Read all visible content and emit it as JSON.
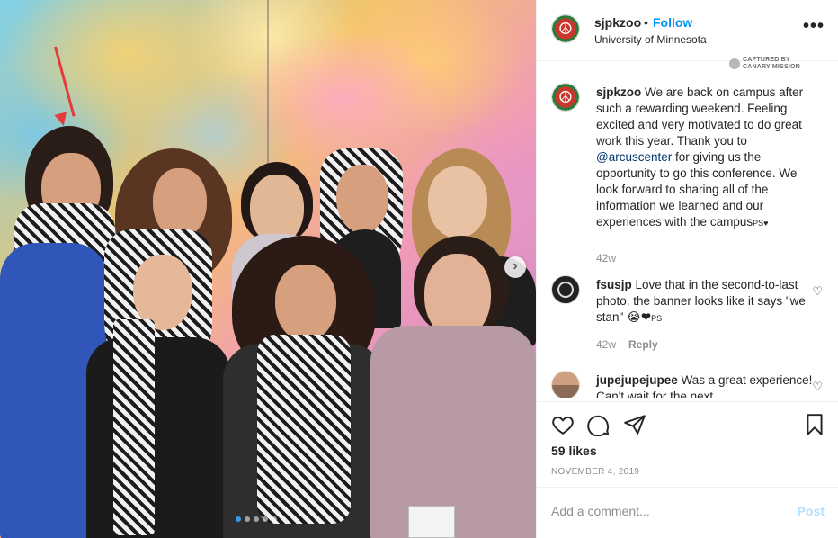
{
  "post": {
    "username": "sjpkzoo",
    "separator": "•",
    "follow_label": "Follow",
    "location": "University of Minnesota",
    "more_label": "•••",
    "watermark_line1": "CAPTURED BY",
    "watermark_line2": "CANARY MISSION"
  },
  "photo": {
    "next_label": "›",
    "dots": 5,
    "active_dot": 0
  },
  "caption": {
    "username": "sjpkzoo",
    "text_before": " We are back on campus after such a rewarding weekend. Feeling excited and very motivated to do great work this year. Thank you to ",
    "mention": "@arcuscenter",
    "text_after": " for giving us the opportunity to go this conference. We look forward to sharing all of the information we learned and our experiences with the campus",
    "suffix": "PS♥",
    "age": "42w"
  },
  "comments": [
    {
      "username": "fsusjp",
      "text": " Love that in the second-to-last photo, the banner looks like it says \"we stan\" ",
      "emoji": "😭❤",
      "suffix": "PS",
      "age": "42w",
      "reply_label": "Reply"
    },
    {
      "username": "jupejupejupee",
      "text": " Was a great experience! Can't wait for the next"
    }
  ],
  "actions": {
    "likes": "59 likes",
    "date": "NOVEMBER 4, 2019"
  },
  "add_comment": {
    "placeholder": "Add a comment...",
    "post_label": "Post"
  },
  "colors": {
    "link": "#0095f6",
    "mention": "#00376b",
    "muted": "#8e8e8e",
    "post_disabled": "#b2dffc"
  }
}
